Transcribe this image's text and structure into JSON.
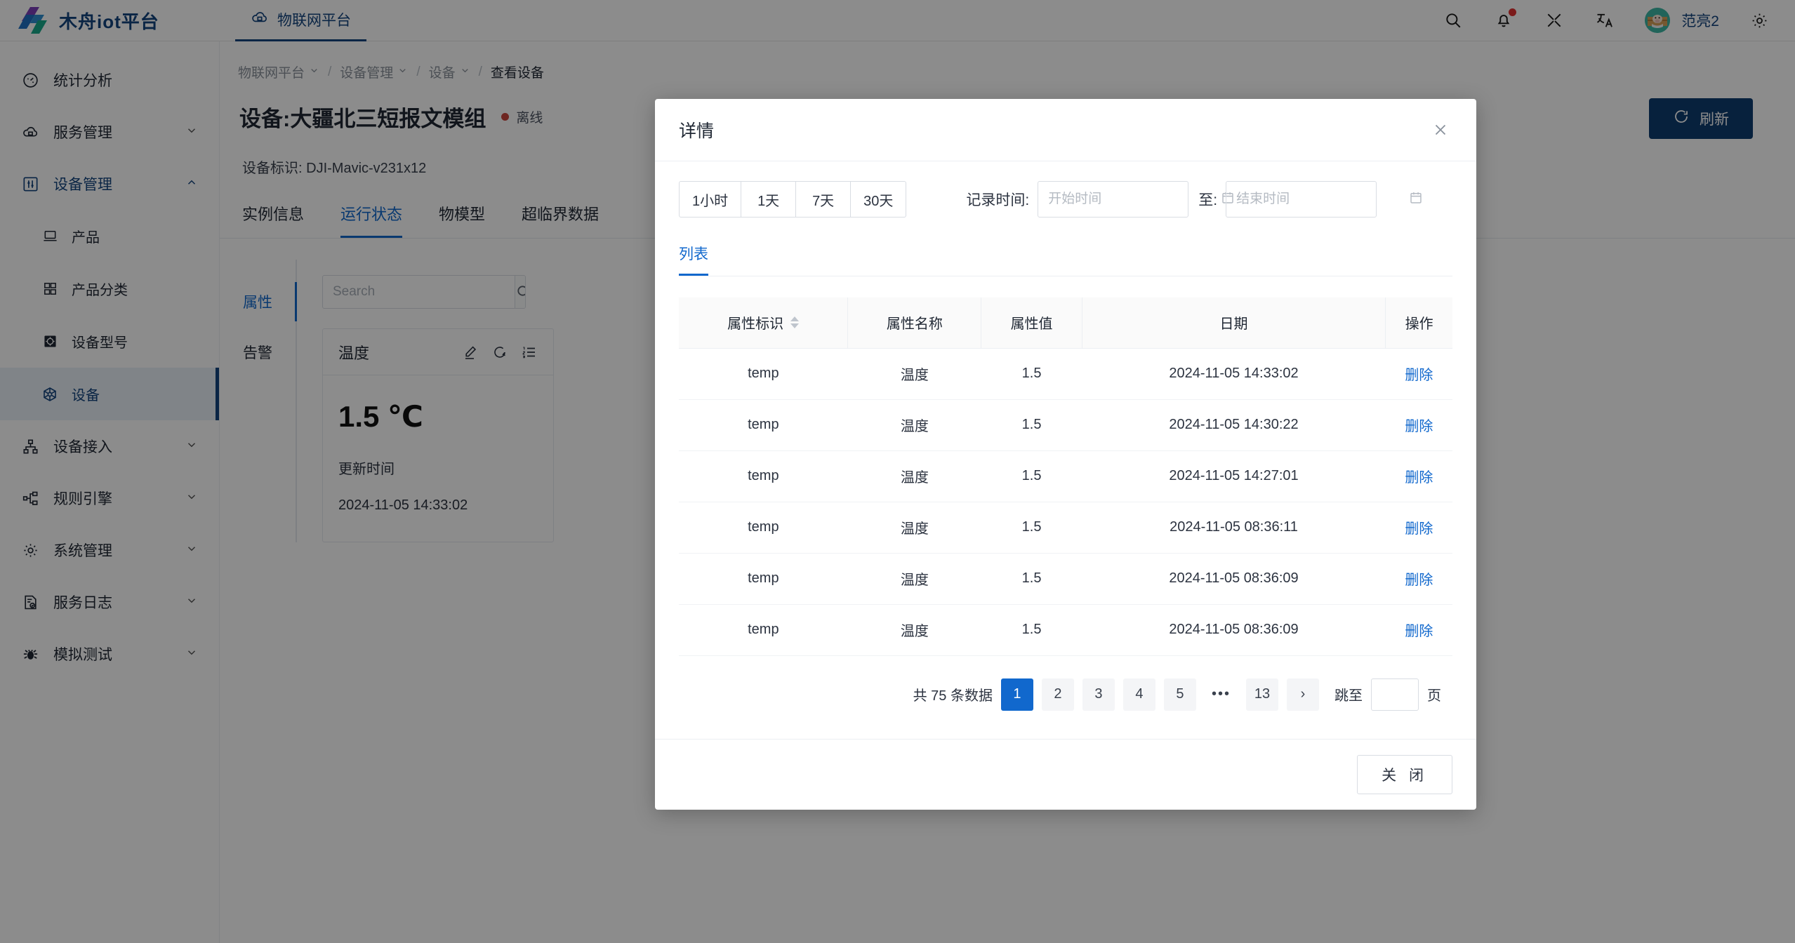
{
  "header": {
    "brand": "木舟iot平台",
    "tab": "物联网平台",
    "user": "范亮2",
    "icons": {
      "search": "search-icon",
      "bell": "bell-icon",
      "fullscreen": "fullscreen-icon",
      "translate": "translate-icon",
      "settings": "gear-icon"
    }
  },
  "sidebar": {
    "items": [
      {
        "label": "统计分析",
        "icon": "dashboard-icon",
        "caret": "",
        "state": "plain"
      },
      {
        "label": "服务管理",
        "icon": "cloud-icon",
        "caret": "⌄",
        "state": "collapsed"
      },
      {
        "label": "设备管理",
        "icon": "sliders-icon",
        "caret": "⌃",
        "state": "expanded"
      },
      {
        "label": "设备接入",
        "icon": "sitemap-icon",
        "caret": "⌄",
        "state": "collapsed"
      },
      {
        "label": "规则引擎",
        "icon": "nodes-icon",
        "caret": "⌄",
        "state": "collapsed"
      },
      {
        "label": "系统管理",
        "icon": "gear-icon",
        "caret": "⌄",
        "state": "collapsed"
      },
      {
        "label": "服务日志",
        "icon": "log-icon",
        "caret": "⌄",
        "state": "collapsed"
      },
      {
        "label": "模拟测试",
        "icon": "bug-icon",
        "caret": "⌄",
        "state": "collapsed"
      }
    ],
    "sub_items": [
      {
        "label": "产品",
        "icon": "product-icon",
        "active": false
      },
      {
        "label": "产品分类",
        "icon": "category-icon",
        "active": false
      },
      {
        "label": "设备型号",
        "icon": "model-icon",
        "active": false
      },
      {
        "label": "设备",
        "icon": "device-icon",
        "active": true
      }
    ]
  },
  "breadcrumb": {
    "items": [
      "物联网平台",
      "设备管理",
      "设备",
      "查看设备"
    ],
    "separator": "/",
    "caret": "⌄"
  },
  "page": {
    "title": "设备:大疆北三短报文模组",
    "status": "离线",
    "status_color": "#c9453d",
    "device_id_label": "设备标识:",
    "device_id": "DJI-Mavic-v231x12",
    "refresh_label": "刷新",
    "refresh_icon": "refresh-icon",
    "refresh_bg": "#0e3d70",
    "tabs": [
      {
        "label": "实例信息",
        "active": false
      },
      {
        "label": "运行状态",
        "active": true
      },
      {
        "label": "物模型",
        "active": false
      },
      {
        "label": "超临界数据",
        "active": false
      }
    ]
  },
  "panel": {
    "vtabs": [
      {
        "label": "属性",
        "active": true
      },
      {
        "label": "告警",
        "active": false
      }
    ],
    "search_placeholder": "Search",
    "search_value": "",
    "search_icon": "search-icon",
    "card": {
      "name": "温度",
      "icons": [
        "edit-icon",
        "refresh-icon",
        "ordered-list-icon"
      ],
      "value": "1.5 ℃",
      "update_label": "更新时间",
      "update_time": "2024-11-05 14:33:02"
    }
  },
  "modal": {
    "title": "详情",
    "close_icon": "close-icon",
    "ranges": [
      {
        "label": "1小时",
        "active": false
      },
      {
        "label": "1天",
        "active": false
      },
      {
        "label": "7天",
        "active": false
      },
      {
        "label": "30天",
        "active": false
      }
    ],
    "record_time_label": "记录时间:",
    "start_placeholder": "开始时间",
    "start_value": "",
    "to_label": "至:",
    "end_placeholder": "结束时间",
    "end_value": "",
    "calendar_icon": "calendar-icon",
    "tab_label": "列表",
    "accent": "#1168cd",
    "table": {
      "columns": [
        "属性标识",
        "属性名称",
        "属性值",
        "日期",
        "操作"
      ],
      "sortable_column": "属性标识",
      "rows": [
        {
          "id": "temp",
          "name": "温度",
          "value": "1.5",
          "date": "2024-11-05 14:33:02",
          "action": "删除"
        },
        {
          "id": "temp",
          "name": "温度",
          "value": "1.5",
          "date": "2024-11-05 14:30:22",
          "action": "删除"
        },
        {
          "id": "temp",
          "name": "温度",
          "value": "1.5",
          "date": "2024-11-05 14:27:01",
          "action": "删除"
        },
        {
          "id": "temp",
          "name": "温度",
          "value": "1.5",
          "date": "2024-11-05 08:36:11",
          "action": "删除"
        },
        {
          "id": "temp",
          "name": "温度",
          "value": "1.5",
          "date": "2024-11-05 08:36:09",
          "action": "删除"
        },
        {
          "id": "temp",
          "name": "温度",
          "value": "1.5",
          "date": "2024-11-05 08:36:09",
          "action": "删除"
        }
      ]
    },
    "pagination": {
      "total_text": "共 75 条数据",
      "pages": [
        "1",
        "2",
        "3",
        "4",
        "5",
        "•••",
        "13"
      ],
      "current": "1",
      "next_icon": "›",
      "jump_label": "跳至",
      "jump_value": "",
      "page_unit": "页"
    },
    "footer_close": "关 闭"
  }
}
